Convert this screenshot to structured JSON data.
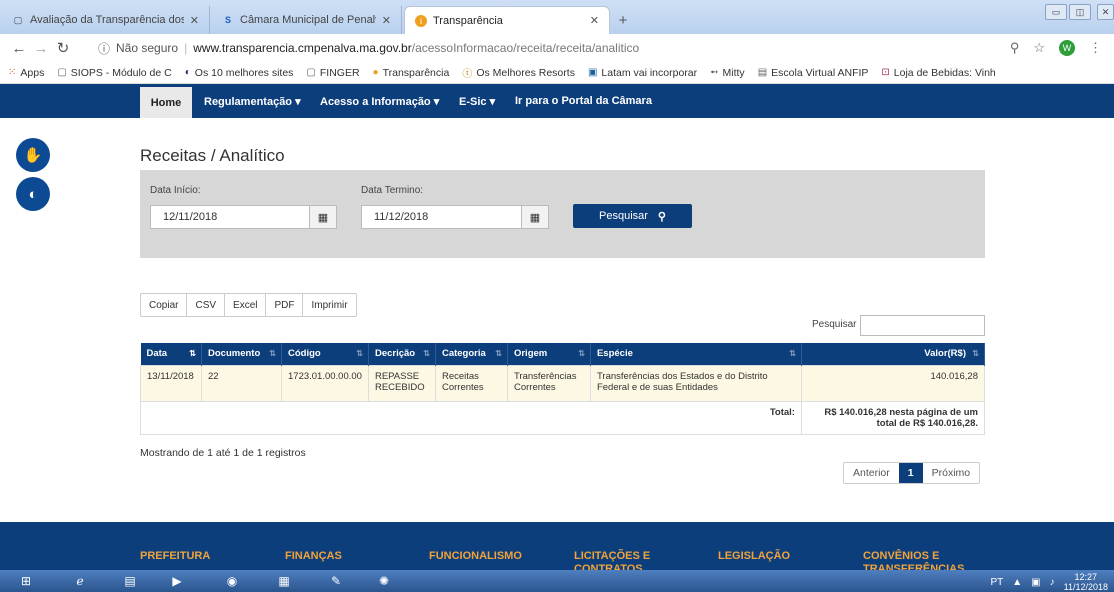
{
  "browser": {
    "tabs": [
      {
        "label": "Avaliação da Transparência dos",
        "icon": "page-icon"
      },
      {
        "label": "Câmara Municipal de Penalva",
        "icon": "site-logo-icon"
      },
      {
        "label": "Transparência",
        "icon": "info-icon"
      }
    ],
    "url": {
      "security": "Não seguro",
      "host": "www.transparencia.cmpenalva.ma.gov.br",
      "path": "/acessoInformacao/receita/receita/analitico"
    },
    "profile_initial": "W",
    "bookmarks": [
      {
        "label": "Apps",
        "icon": "apps-grid-icon"
      },
      {
        "label": "SIOPS - Módulo de C",
        "icon": "page-icon"
      },
      {
        "label": "Os 10 melhores sites",
        "icon": "circle-icon"
      },
      {
        "label": "FINGER",
        "icon": "page-icon"
      },
      {
        "label": "Transparência",
        "icon": "info-icon"
      },
      {
        "label": "Os Melhores Resorts",
        "icon": "resort-icon"
      },
      {
        "label": "Latam vai incorporar",
        "icon": "news-icon"
      },
      {
        "label": "Mitty",
        "icon": "arrow-icon"
      },
      {
        "label": "Escola Virtual ANFIP",
        "icon": "school-icon"
      },
      {
        "label": "Loja de Bebidas: Vinh",
        "icon": "shop-icon"
      }
    ]
  },
  "nav": {
    "home": "Home",
    "items": [
      "Regulamentação ▾",
      "Acesso a Informação ▾",
      "E-Sic ▾",
      "Ir para o Portal da Câmara"
    ]
  },
  "page": {
    "title": "Receitas / Analítico"
  },
  "filter": {
    "start_label": "Data Início:",
    "start_value": "12/11/2018",
    "end_label": "Data Termino:",
    "end_value": "11/12/2018",
    "search_button": "Pesquisar"
  },
  "exports": [
    "Copiar",
    "CSV",
    "Excel",
    "PDF",
    "Imprimir"
  ],
  "table_search_label": "Pesquisar",
  "table": {
    "headers": [
      "Data",
      "Documento",
      "Código",
      "Decrição",
      "Categoria",
      "Origem",
      "Espécie",
      "Valor(R$)"
    ],
    "rows": [
      [
        "13/11/2018",
        "22",
        "1723.01.00.00.00",
        "REPASSE RECEBIDO",
        "Receitas Correntes",
        "Transferências Correntes",
        "Transferências dos Estados e do Distrito Federal e de suas Entidades",
        "140.016,28"
      ]
    ],
    "total_label": "Total:",
    "total_value": "R$ 140.016,28 nesta página de um total de R$ 140.016,28."
  },
  "info": "Mostrando de 1 até 1 de 1 registros",
  "pager": {
    "prev": "Anterior",
    "current": "1",
    "next": "Próximo"
  },
  "footer": [
    "PREFEITURA",
    "FINANÇAS",
    "FUNCIONALISMO",
    "LICITAÇÕES E CONTRATOS",
    "LEGISLAÇÃO",
    "CONVÊNIOS E TRANSFERÊNCIAS"
  ],
  "taskbar": {
    "lang": "PT",
    "time": "12:27",
    "date": "11/12/2018"
  }
}
